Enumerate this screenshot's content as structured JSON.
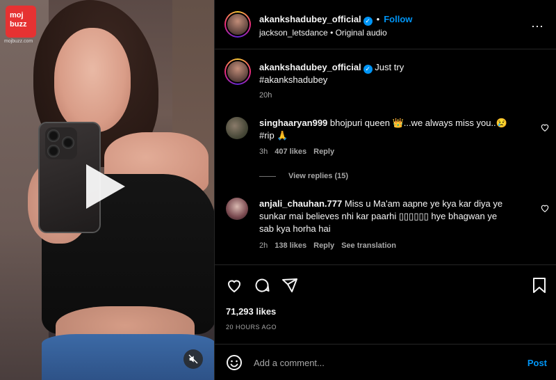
{
  "brand": {
    "name": "moj buzz",
    "name_line1": "moj",
    "name_line2": "buzz",
    "url": "mojbuzz.com"
  },
  "post": {
    "author": "akankshadubey_official",
    "follow_label": "Follow",
    "separator": "•",
    "audio": "jackson_letsdance • Original audio",
    "caption_text": "Just try",
    "caption_tag": "#akankshadubey",
    "caption_time": "20h",
    "likes": "71,293 likes",
    "date": "20 HOURS AGO",
    "more_icon": "⋯"
  },
  "comments": [
    {
      "user": "singhaaryan999",
      "text_line1": "bhojpuri queen 👑...we always miss you..😢",
      "text_line2": "#rip 🙏",
      "time": "3h",
      "likes": "407 likes",
      "reply": "Reply",
      "view_replies": "View replies (15)"
    },
    {
      "user": "anjali_chauhan.777",
      "text_line1": "Miss u Ma'am aapne ye kya kar diya ye",
      "text_line2": "sunkar mai believes nhi kar paarhi ▯▯▯▯▯▯ hye bhagwan ye",
      "text_line3": "sab kya horha hai",
      "time": "2h",
      "likes": "138 likes",
      "reply": "Reply",
      "translation": "See translation"
    }
  ],
  "composer": {
    "placeholder": "Add a comment...",
    "post_label": "Post"
  },
  "colors": {
    "accent": "#0095f6",
    "background": "#000000",
    "muted": "#a8a8a8"
  }
}
